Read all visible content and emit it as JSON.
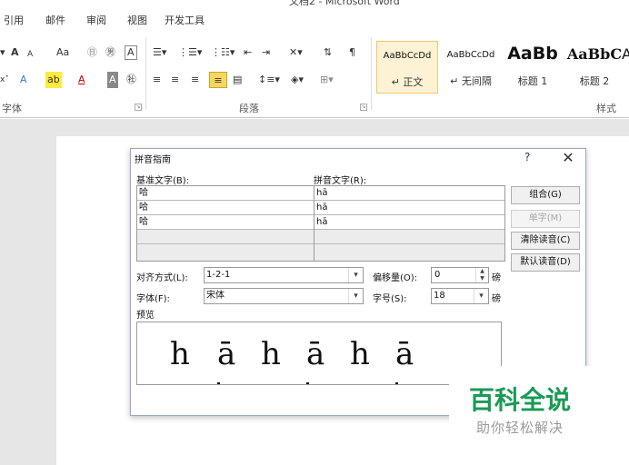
{
  "window": {
    "title": "文档2 - Microsoft Word"
  },
  "tabs": [
    {
      "label": "引用"
    },
    {
      "label": "邮件"
    },
    {
      "label": "审阅"
    },
    {
      "label": "视图"
    },
    {
      "label": "开发工具"
    }
  ],
  "ribbon": {
    "font_group": {
      "label": "字体",
      "row1": [
        "A",
        "A",
        "Aa",
        "㊐",
        "A"
      ],
      "row2": [
        "A",
        "A",
        "A",
        "㊓"
      ]
    },
    "paragraph_group": {
      "label": "段落"
    },
    "styles_group": {
      "label": "样式",
      "styles": [
        {
          "sample": "AaBbCcDd",
          "name": "↵ 正文",
          "active": true
        },
        {
          "sample": "AaBbCcDd",
          "name": "↵ 无间隔",
          "active": false
        },
        {
          "sample": "AaBb",
          "name": "标题 1",
          "active": false
        },
        {
          "sample": "AaBbC",
          "name": "标题 2",
          "active": false
        },
        {
          "sample": "A",
          "name": "",
          "active": false
        }
      ]
    }
  },
  "dialog": {
    "title": "拼音指南",
    "help": "?",
    "close": "✕",
    "base_text_label": "基准文字(B):",
    "ruby_text_label": "拼音文字(R):",
    "rows": [
      {
        "base": "哈",
        "ruby": "hā"
      },
      {
        "base": "哈",
        "ruby": "hā"
      },
      {
        "base": "哈",
        "ruby": "hā"
      }
    ],
    "buttons": {
      "group": "组合(G)",
      "mono": "单字(M)",
      "clear": "清除读音(C)",
      "default": "默认读音(D)"
    },
    "alignment_label": "对齐方式(L):",
    "alignment_value": "1-2-1",
    "offset_label": "偏移量(O):",
    "offset_value": "0",
    "offset_unit": "磅",
    "font_label": "字体(F):",
    "font_value": "宋体",
    "size_label": "字号(S):",
    "size_value": "18",
    "size_unit": "磅",
    "preview_label": "预览",
    "preview_glyphs": [
      "h",
      "ā",
      "h",
      "ā",
      "h",
      "ā"
    ]
  },
  "watermark": {
    "title": "百科全说",
    "subtitle": "助你轻松解决"
  }
}
